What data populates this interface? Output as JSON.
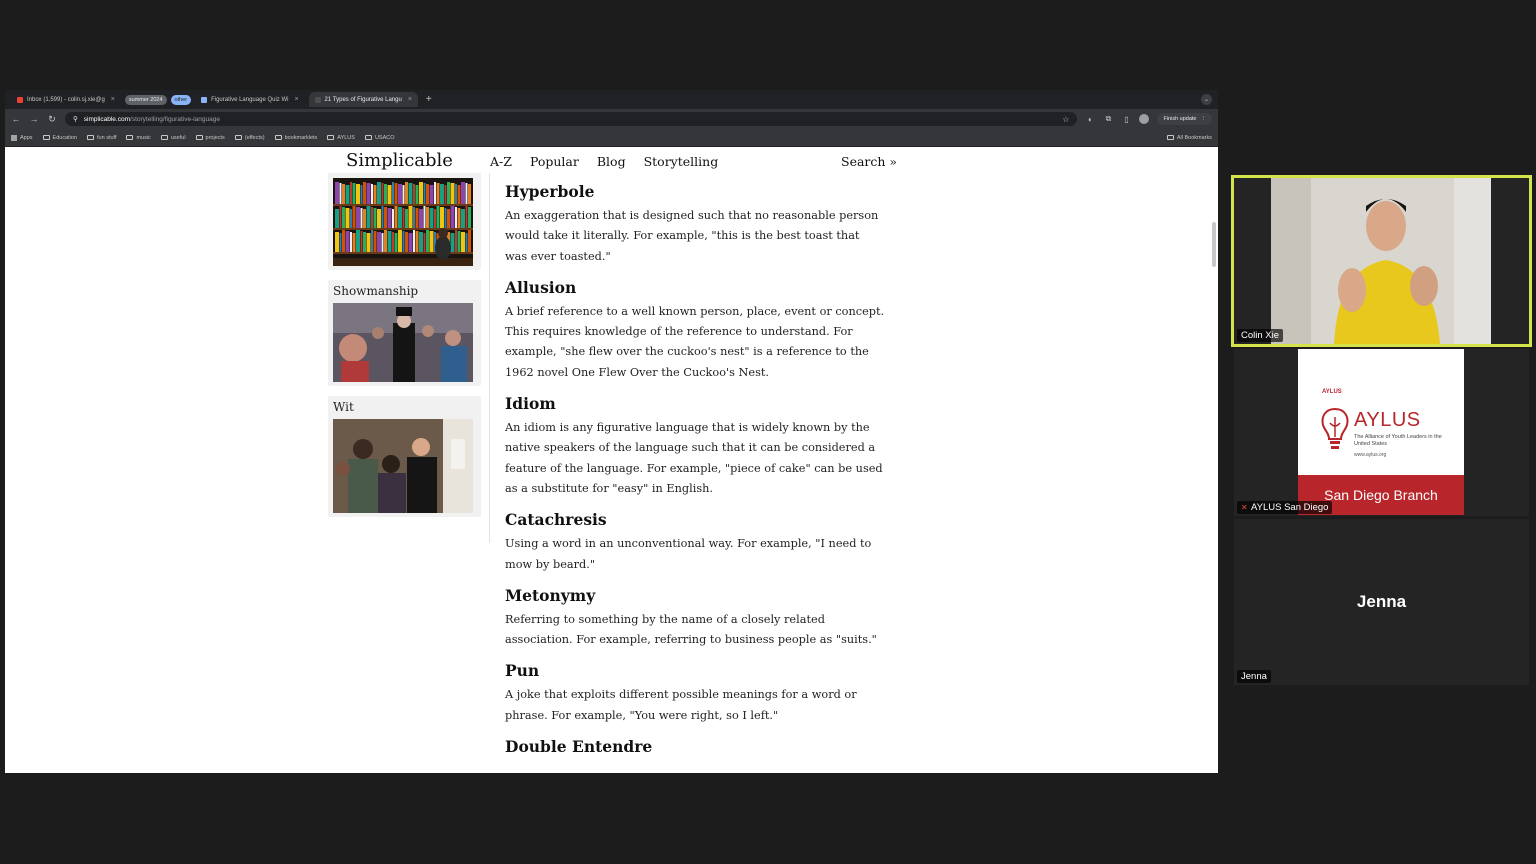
{
  "tabs": [
    {
      "label": "Inbox (1,599) - colin.sj.xie@g",
      "icon": "gmail-icon",
      "active": false
    },
    {
      "group": "summer 2024",
      "style": "gray"
    },
    {
      "group": "other",
      "style": "blue"
    },
    {
      "label": "Figurative Language Quiz Wi",
      "icon": "quiz-icon",
      "active": false
    },
    {
      "label": "21 Types of Figurative Langu",
      "icon": "simplicable-icon",
      "active": true
    }
  ],
  "address": {
    "host": "simplicable.com",
    "path": "/storytelling/figurative-language"
  },
  "toolbar": {
    "finish_update": "Finish update"
  },
  "bookmarks": [
    "Apps",
    "Education",
    "fun stuff",
    "music",
    "useful",
    "projects",
    "(effects)",
    "bookmarklets",
    "AYLUS",
    "USACO"
  ],
  "all_bookmarks": "All Bookmarks",
  "site": {
    "logo": "Simplicable",
    "nav": [
      "A-Z",
      "Popular",
      "Blog",
      "Storytelling"
    ],
    "search": "Search »"
  },
  "sidebar": {
    "cards": [
      {
        "caption": ""
      },
      {
        "caption": "Showmanship"
      },
      {
        "caption": "Wit"
      }
    ]
  },
  "article": {
    "terms": [
      {
        "title": "Hyperbole",
        "text": "An exaggeration that is designed such that no reasonable person would take it literally. For example, \"this is the best toast that was ever toasted.\""
      },
      {
        "title": "Allusion",
        "text": "A brief reference to a well known person, place, event or concept. This requires knowledge of the reference to understand. For example, \"she flew over the cuckoo's nest\" is a reference to the 1962 novel One Flew Over the Cuckoo's Nest."
      },
      {
        "title": "Idiom",
        "text": "An idiom is any figurative language that is widely known by the native speakers of the language such that it can be considered a feature of the language. For example, \"piece of cake\" can be used as a substitute for \"easy\" in English."
      },
      {
        "title": "Catachresis",
        "text": "Using a word in an unconventional way. For example, \"I need to mow by beard.\""
      },
      {
        "title": "Metonymy",
        "text": "Referring to something by the name of a closely related association. For example, referring to business people as \"suits.\""
      },
      {
        "title": "Pun",
        "text": "A joke that exploits different possible meanings for a word or phrase. For example, \"You were right, so I left.\""
      },
      {
        "title": "Double Entendre",
        "text": ""
      }
    ]
  },
  "call": {
    "participants": [
      {
        "name": "Colin Xie",
        "speaking": true
      },
      {
        "name": "AYLUS San Diego",
        "muted": true
      },
      {
        "name": "Jenna"
      }
    ],
    "aylus_card": {
      "small": "AYLUS",
      "brand": "AYLUS",
      "tagline": "The Alliance of Youth Leaders in the United States",
      "url": "www.aylus.org",
      "branch": "San Diego Branch"
    }
  },
  "colors": {
    "speaker_highlight": "#d5e34a",
    "aylus_red": "#b8262c"
  }
}
